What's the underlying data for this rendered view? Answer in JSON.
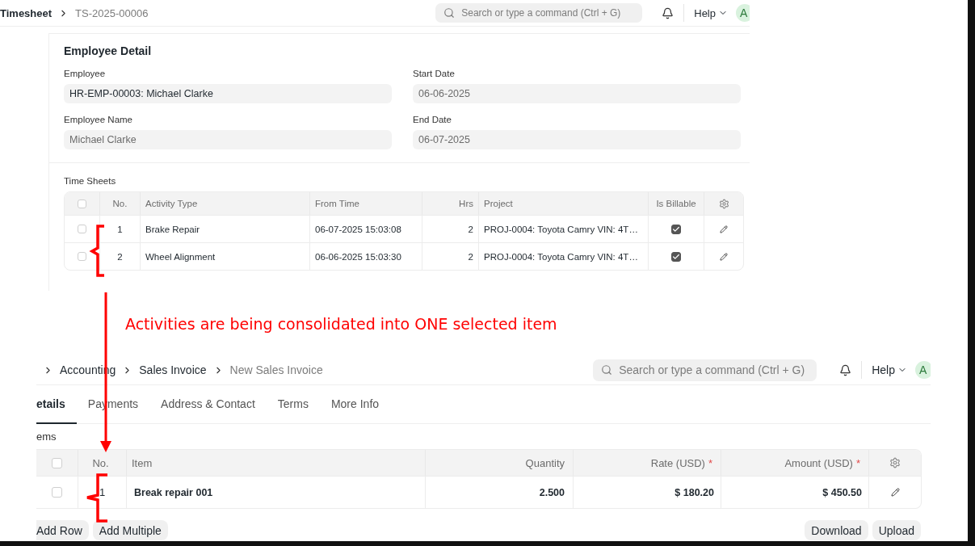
{
  "timesheet_screen": {
    "breadcrumb": [
      "Timesheet",
      "TS-2025-00006"
    ],
    "search": {
      "placeholder": "Search or type a command (Ctrl + G)"
    },
    "help": "Help",
    "avatar": "A",
    "section_title": "Employee Detail",
    "fields": [
      {
        "label": "Employee",
        "value": "HR-EMP-00003: Michael Clarke",
        "readonly": false
      },
      {
        "label": "Start Date",
        "value": "06-06-2025",
        "readonly": true
      },
      {
        "label": "Employee Name",
        "value": "Michael Clarke",
        "readonly": true
      },
      {
        "label": "End Date",
        "value": "06-07-2025",
        "readonly": true
      }
    ],
    "table": {
      "title": "Time Sheets",
      "all_selected": false,
      "columns": [
        "No.",
        "Activity Type",
        "From Time",
        "Hrs",
        "Project",
        "Is Billable"
      ],
      "rows": [
        {
          "no": "1",
          "activity_type": "Brake Repair",
          "from_time": "06-07-2025 15:03:08",
          "hrs": "2",
          "project": "PROJ-0004: Toyota Camry VIN: 4T…",
          "is_billable": true,
          "selected": false
        },
        {
          "no": "2",
          "activity_type": "Wheel Alignment",
          "from_time": "06-06-2025 15:03:30",
          "hrs": "2",
          "project": "PROJ-0004: Toyota Camry VIN: 4T…",
          "is_billable": true,
          "selected": false
        }
      ]
    }
  },
  "annotation": "Activities are being consolidated into ONE selected item",
  "invoice_screen": {
    "breadcrumb": [
      "Accounting",
      "Sales Invoice",
      "New Sales Invoice"
    ],
    "search": {
      "placeholder": "Search or type a command (Ctrl + G)"
    },
    "help": "Help",
    "avatar": "A",
    "tabs": [
      {
        "label": "etails",
        "selected": true
      },
      {
        "label": "Payments",
        "selected": false
      },
      {
        "label": "Address & Contact",
        "selected": false
      },
      {
        "label": "Terms",
        "selected": false
      },
      {
        "label": "More Info",
        "selected": false
      }
    ],
    "section_label": "ems",
    "table": {
      "all_selected": false,
      "columns": [
        {
          "label": "No."
        },
        {
          "label": "Item"
        },
        {
          "label": "Quantity"
        },
        {
          "label": "Rate (USD)",
          "required_mark": "*"
        },
        {
          "label": "Amount (USD)",
          "required_mark": "*"
        }
      ],
      "rows": [
        {
          "no": "1",
          "item": "Break repair 001",
          "quantity": "2.500",
          "rate": "$ 180.20",
          "amount": "$ 450.50",
          "selected": false
        }
      ]
    },
    "buttons_left": [
      "Add Row",
      "Add Multiple"
    ],
    "buttons_right": [
      "Download",
      "Upload"
    ]
  }
}
